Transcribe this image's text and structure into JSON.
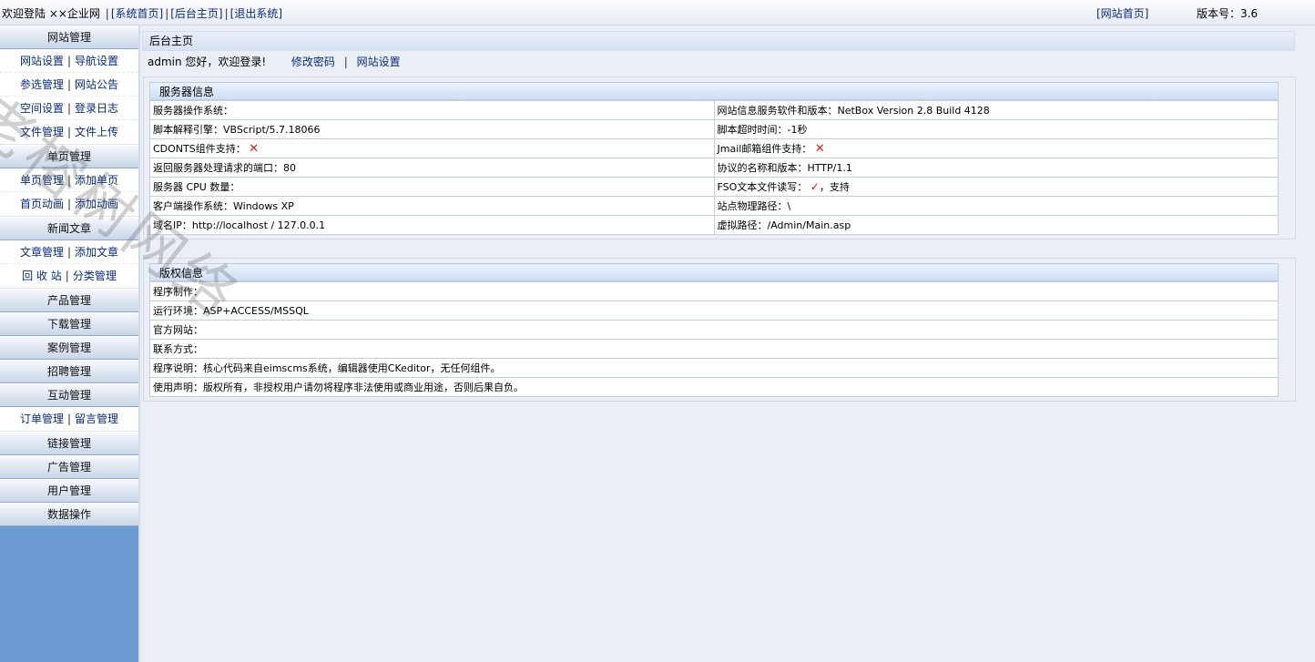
{
  "topbar": {
    "welcome": "欢迎登陆 ××企业网",
    "links": [
      "[系统首页]",
      "[后台主页]",
      "[退出系统]"
    ],
    "site_home": "[网站首页]",
    "version": "版本号：3.6"
  },
  "sidebar": {
    "sections": [
      {
        "head": "网站管理",
        "rows": [
          [
            "网站设置",
            "导航设置"
          ],
          [
            "参选管理",
            "网站公告"
          ],
          [
            "空间设置",
            "登录日志"
          ],
          [
            "文件管理",
            "文件上传"
          ]
        ]
      },
      {
        "head": "单页管理",
        "rows": [
          [
            "单页管理",
            "添加单页"
          ],
          [
            "首页动画",
            "添加动画"
          ]
        ]
      },
      {
        "head": "新闻文章",
        "rows": [
          [
            "文章管理",
            "添加文章"
          ],
          [
            "回 收 站",
            "分类管理"
          ]
        ]
      },
      {
        "head": "产品管理",
        "rows": []
      },
      {
        "head": "下载管理",
        "rows": []
      },
      {
        "head": "案例管理",
        "rows": []
      },
      {
        "head": "招聘管理",
        "rows": []
      },
      {
        "head": "互动管理",
        "rows": [
          [
            "订单管理",
            "留言管理"
          ]
        ]
      },
      {
        "head": "链接管理",
        "rows": []
      },
      {
        "head": "广告管理",
        "rows": []
      },
      {
        "head": "用户管理",
        "rows": []
      },
      {
        "head": "数据操作",
        "rows": []
      }
    ]
  },
  "main": {
    "crumb": "后台主页",
    "welcome": "admin 您好，欢迎登录!",
    "change_password": "修改密码",
    "site_settings": "网站设置"
  },
  "server": {
    "title": "服务器信息",
    "rows": [
      [
        "服务器操作系统：",
        "网站信息服务软件和版本：NetBox Version 2.8 Build 4128"
      ],
      [
        "脚本解释引擎：VBScript/5.7.18066",
        "脚本超时时间：-1秒"
      ],
      [
        "CDONTS组件支持：",
        "Jmail邮箱组件支持："
      ],
      [
        "返回服务器处理请求的端口：80",
        "协议的名称和版本：HTTP/1.1"
      ],
      [
        "服务器 CPU 数量：",
        "FSO文本文件读写："
      ],
      [
        "客户端操作系统：Windows XP",
        "站点物理路径：\\"
      ],
      [
        "域名IP：http://localhost / 127.0.0.1",
        "虚拟路径：/Admin/Main.asp"
      ]
    ],
    "fso_support": "，支持"
  },
  "copyright": {
    "title": "版权信息",
    "rows": [
      "程序制作：",
      "运行环境：ASP+ACCESS/MSSQL",
      "官方网站：",
      "联系方式：",
      "程序说明：核心代码来自eimscms系统，编辑器使用CKeditor，无任何组件。",
      "使用声明：版权所有，非授权用户请勿将程序非法使用或商业用途，否则后果自负。"
    ]
  },
  "watermark": "老榕树网络"
}
